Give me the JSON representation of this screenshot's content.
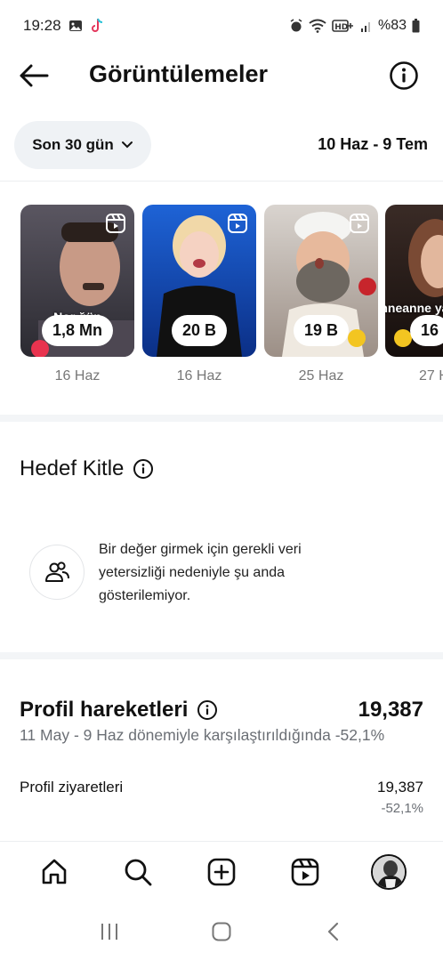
{
  "status_bar": {
    "time": "19:28",
    "battery": "%83"
  },
  "header": {
    "title": "Görüntülemeler"
  },
  "filter": {
    "range_label": "Son 30 gün",
    "date_range": "10 Haz - 9 Tem"
  },
  "reels": [
    {
      "views": "1,8 Mn",
      "date": "16 Haz",
      "overlay": "Nor   ğün",
      "bg1": "#5a5661",
      "bg2": "#2b2a31"
    },
    {
      "views": "20 B",
      "date": "16 Haz",
      "overlay": "",
      "bg1": "#1e63d6",
      "bg2": "#0b2f86"
    },
    {
      "views": "19 B",
      "date": "25 Haz",
      "overlay": "",
      "bg1": "#d9d4cf",
      "bg2": "#9c8f86"
    },
    {
      "views": "16",
      "date": "27 H",
      "overlay": "Anneanne yapa",
      "bg1": "#3a2b26",
      "bg2": "#150e0c"
    }
  ],
  "audience": {
    "title": "Hedef Kitle",
    "message": "Bir değer girmek için gerekli veri yetersizliği nedeniyle şu anda gösterilemiyor."
  },
  "profile_activity": {
    "title": "Profil hareketleri",
    "total": "19,387",
    "comparison": "11 May - 9 Haz dönemiyle karşılaştırıldığında -52,1%",
    "visits_label": "Profil ziyaretleri",
    "visits_value": "19,387",
    "visits_change": "-52,1%"
  }
}
